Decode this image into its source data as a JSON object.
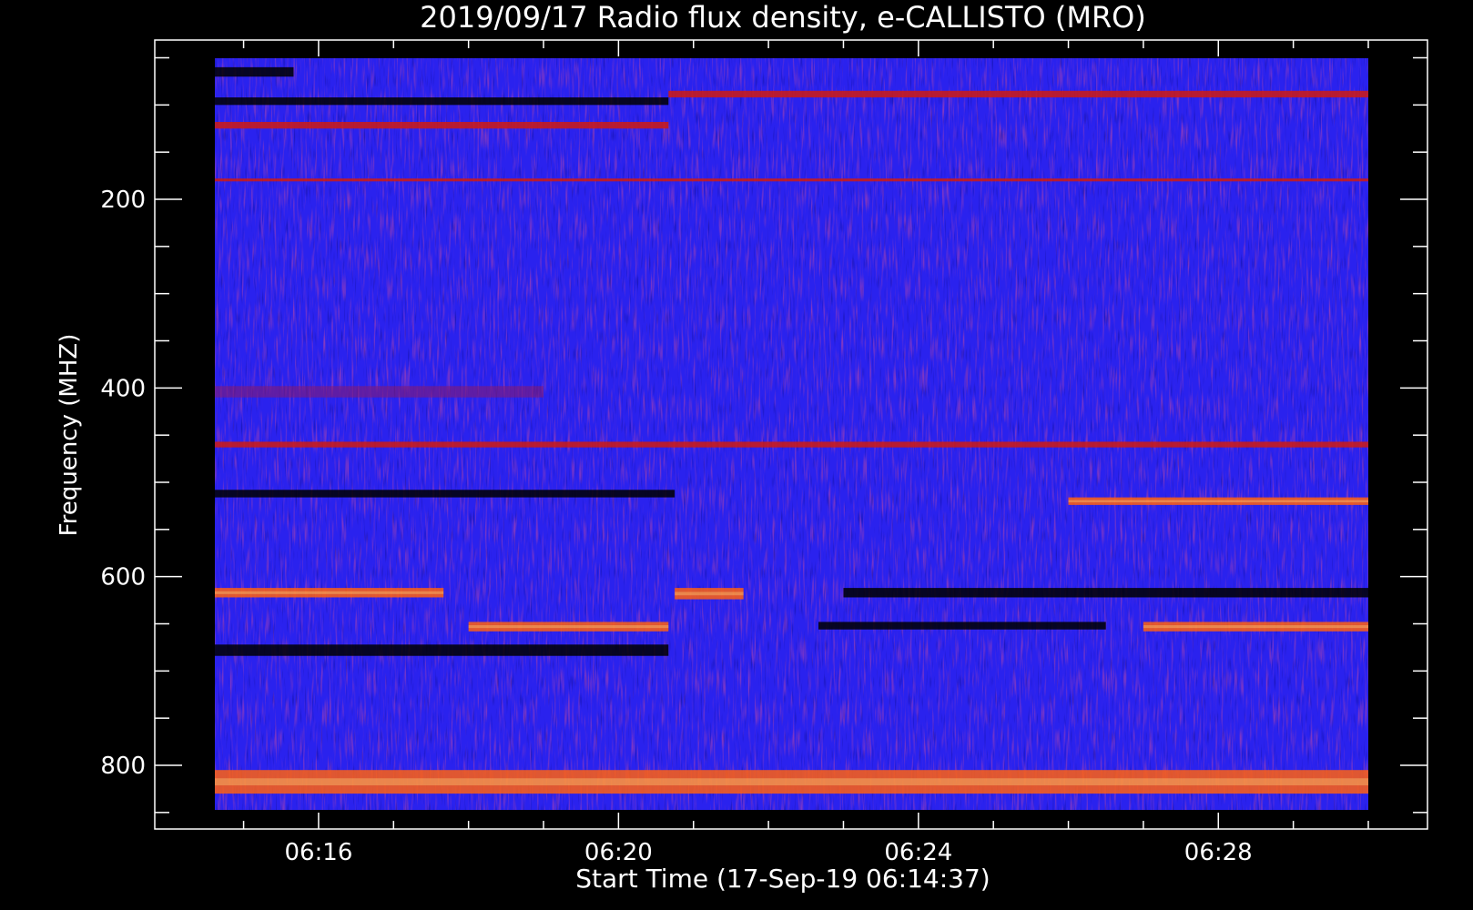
{
  "chart_data": {
    "type": "heatmap",
    "title": "2019/09/17  Radio flux density, e-CALLISTO (MRO)",
    "xlabel": "Start Time (17-Sep-19 06:14:37)",
    "ylabel": "Frequency (MHZ)",
    "xlim": [
      "06:14:37",
      "06:30:00"
    ],
    "ylim": [
      850,
      50
    ],
    "x_ticks": [
      "06:16",
      "06:20",
      "06:24",
      "06:28"
    ],
    "y_ticks": [
      200,
      400,
      600,
      800
    ],
    "colorscale": [
      "#000000",
      "#1a00b0",
      "#2a2af0",
      "#8a1a6a",
      "#d01a10",
      "#ff6010",
      "#ffe080"
    ],
    "background_color": "#2a22ee",
    "bands": [
      {
        "freq_from": 60,
        "freq_to": 70,
        "time_from": "06:14:37",
        "time_to": "06:15:40",
        "level": "dark"
      },
      {
        "freq_from": 92,
        "freq_to": 100,
        "time_from": "06:14:37",
        "time_to": "06:20:40",
        "level": "dark"
      },
      {
        "freq_from": 85,
        "freq_to": 92,
        "time_from": "06:20:40",
        "time_to": "06:30:00",
        "level": "red"
      },
      {
        "freq_from": 118,
        "freq_to": 125,
        "time_from": "06:14:37",
        "time_to": "06:20:40",
        "level": "red"
      },
      {
        "freq_from": 178,
        "freq_to": 181,
        "time_from": "06:14:37",
        "time_to": "06:30:00",
        "level": "red"
      },
      {
        "freq_from": 398,
        "freq_to": 410,
        "time_from": "06:14:37",
        "time_to": "06:19:00",
        "level": "purple"
      },
      {
        "freq_from": 457,
        "freq_to": 463,
        "time_from": "06:14:37",
        "time_to": "06:30:00",
        "level": "red"
      },
      {
        "freq_from": 508,
        "freq_to": 516,
        "time_from": "06:14:37",
        "time_to": "06:20:45",
        "level": "dark"
      },
      {
        "freq_from": 516,
        "freq_to": 524,
        "time_from": "06:26:00",
        "time_to": "06:30:00",
        "level": "bright"
      },
      {
        "freq_from": 612,
        "freq_to": 622,
        "time_from": "06:14:37",
        "time_to": "06:17:40",
        "level": "bright"
      },
      {
        "freq_from": 612,
        "freq_to": 624,
        "time_from": "06:20:45",
        "time_to": "06:21:40",
        "level": "bright"
      },
      {
        "freq_from": 612,
        "freq_to": 622,
        "time_from": "06:23:00",
        "time_to": "06:30:00",
        "level": "dark"
      },
      {
        "freq_from": 648,
        "freq_to": 658,
        "time_from": "06:18:00",
        "time_to": "06:20:40",
        "level": "bright"
      },
      {
        "freq_from": 648,
        "freq_to": 658,
        "time_from": "06:27:00",
        "time_to": "06:30:00",
        "level": "bright"
      },
      {
        "freq_from": 648,
        "freq_to": 656,
        "time_from": "06:22:40",
        "time_to": "06:26:30",
        "level": "dark"
      },
      {
        "freq_from": 672,
        "freq_to": 684,
        "time_from": "06:14:37",
        "time_to": "06:20:40",
        "level": "dark"
      },
      {
        "freq_from": 805,
        "freq_to": 830,
        "time_from": "06:14:37",
        "time_to": "06:30:00",
        "level": "bright"
      }
    ]
  }
}
